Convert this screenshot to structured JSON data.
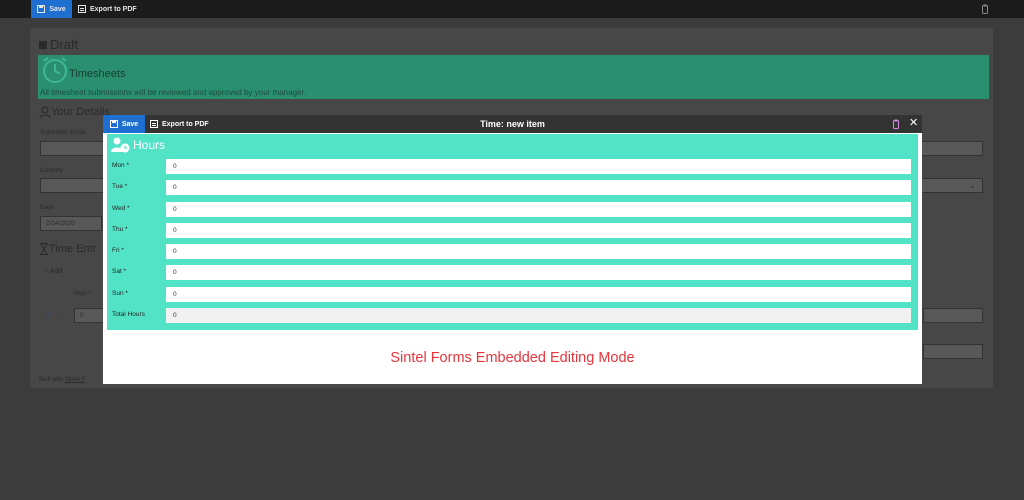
{
  "toolbar": {
    "save_label": "Save",
    "export_label": "Export to PDF"
  },
  "background_form": {
    "status": "Draft",
    "banner": {
      "title": "Timesheets",
      "subtitle": "All timesheet submissions will be reviewed and approved by your manager."
    },
    "your_details_title": "Your Details",
    "fields": {
      "submitter_email_label": "Submitter Email",
      "country_label": "Country",
      "date_label": "Date",
      "date_value": "2/24/2020"
    },
    "time_entries_title": "Time Entr",
    "add_label": "Add",
    "mon_header": "Mon *",
    "row_value": "0",
    "footer_prefix": "Built with ",
    "footer_link": "Sintel F"
  },
  "modal": {
    "save_label": "Save",
    "export_label": "Export to PDF",
    "title": "Time: new item",
    "close_glyph": "✕",
    "section_title": "Hours",
    "rows": [
      {
        "label": "Mon *",
        "value": "0"
      },
      {
        "label": "Tue *",
        "value": "0"
      },
      {
        "label": "Wed *",
        "value": "0"
      },
      {
        "label": "Thu *",
        "value": "0"
      },
      {
        "label": "Fri *",
        "value": "0"
      },
      {
        "label": "Sat *",
        "value": "0"
      },
      {
        "label": "Sun *",
        "value": "0"
      },
      {
        "label": "Total Hours",
        "value": "0"
      }
    ],
    "embedded_caption": "Sintel Forms Embedded Editing Mode"
  },
  "colors": {
    "accent_blue": "#1f6fd0",
    "banner_green": "#2a8f6f",
    "panel_teal": "#52e3c6",
    "caption_red": "#e8343c"
  },
  "icons": [
    "save-icon",
    "pdf-icon",
    "clipboard-icon",
    "close-icon",
    "clock-icon",
    "user-icon",
    "hourglass-icon",
    "users-clock-icon"
  ]
}
